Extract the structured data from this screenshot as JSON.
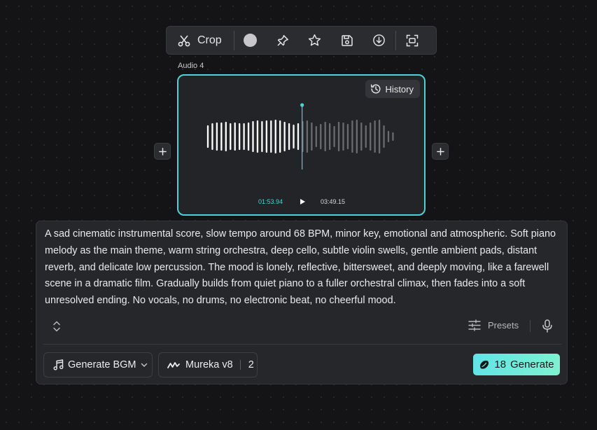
{
  "toolbar": {
    "crop_label": "Crop",
    "swatch_color": "#c8c8cc",
    "icons": [
      "scissors-icon",
      "color-swatch",
      "pin-icon",
      "star-icon",
      "save-icon",
      "download-icon",
      "focus-icon"
    ]
  },
  "audio": {
    "label": "Audio 4",
    "history_label": "History",
    "current_time": "01:53.94",
    "duration": "03:49.15",
    "played_fraction": 0.497,
    "accent_color": "#4fd1d9"
  },
  "prompt": {
    "text": "A sad cinematic instrumental score, slow tempo around 68 BPM, minor key, emotional and atmospheric. Soft piano melody as the main theme, warm string orchestra, deep cello, subtle violin swells, gentle ambient pads, distant reverb, and delicate low percussion. The mood is lonely, reflective, bittersweet, and deeply moving, like a farewell scene in a dramatic film. Gradually builds from quiet piano to a fuller orchestral climax, then fades into a soft unresolved ending. No vocals, no drums, no electronic beat, no cheerful mood.",
    "presets_label": "Presets"
  },
  "controls": {
    "mode_label": "Generate BGM",
    "model_label": "Mureka v8",
    "model_count": "2",
    "generate_cost": "18",
    "generate_label": "Generate",
    "generate_gradient": [
      "#62e3e6",
      "#7ef2d0"
    ]
  }
}
